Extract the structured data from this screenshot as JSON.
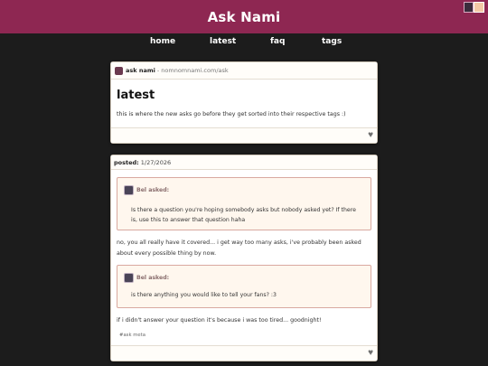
{
  "header": {
    "title": "Ask Nami"
  },
  "nav": {
    "items": [
      {
        "label": "home"
      },
      {
        "label": "latest"
      },
      {
        "label": "faq"
      },
      {
        "label": "tags"
      }
    ]
  },
  "blog_post": {
    "blog_name": "ask nami",
    "blog_url": "- nomnomnami.com/ask",
    "title": "latest",
    "text": "this is where the new asks go before they get sorted into their respective tags :)"
  },
  "ask_post": {
    "posted_label": "posted:",
    "posted_date": "1/27/2026",
    "asks": [
      {
        "asker": "Bel asked:",
        "question": "Is there a question you're hoping somebody asks but nobody asked yet? If there is, use this to answer that question haha",
        "answer": "no, you all really have it covered... i get way too many asks, i've probably been asked about every possible thing by now."
      },
      {
        "asker": "Bel asked:",
        "question": "is there anything you would like to tell your fans? :3",
        "answer": "if i didn't answer your question it's because i was too tired... goodnight!"
      }
    ],
    "tag": "#ask meta"
  },
  "colors": {
    "header_bg": "#8e2752",
    "page_bg": "#1c1c1c",
    "ask_box_bg": "#fff7ee",
    "ask_box_border": "#d9a9a0"
  },
  "icons": [
    "blog-avatar-icon",
    "asker-avatar-icon",
    "heart-icon"
  ]
}
